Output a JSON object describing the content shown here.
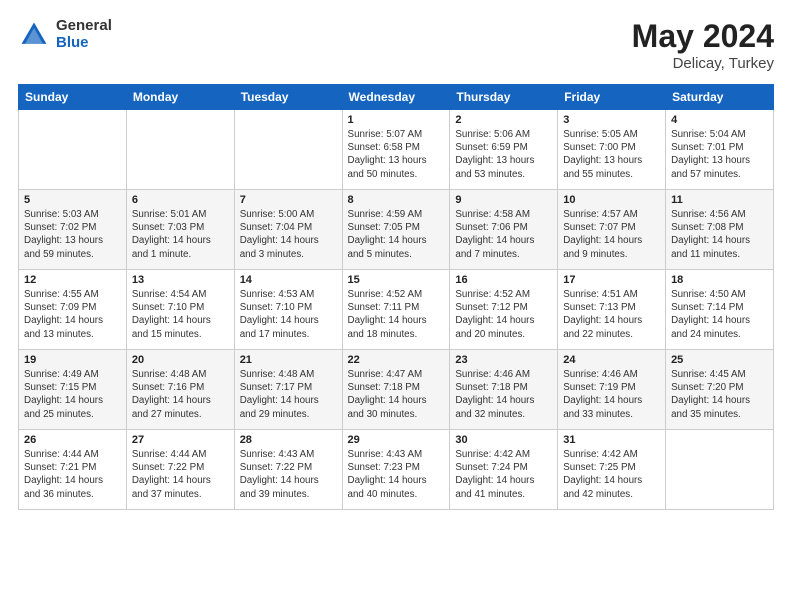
{
  "header": {
    "logo_general": "General",
    "logo_blue": "Blue",
    "title": "May 2024",
    "location": "Delicay, Turkey"
  },
  "days_of_week": [
    "Sunday",
    "Monday",
    "Tuesday",
    "Wednesday",
    "Thursday",
    "Friday",
    "Saturday"
  ],
  "weeks": [
    [
      {
        "day": "",
        "sunrise": "",
        "sunset": "",
        "daylight": ""
      },
      {
        "day": "",
        "sunrise": "",
        "sunset": "",
        "daylight": ""
      },
      {
        "day": "",
        "sunrise": "",
        "sunset": "",
        "daylight": ""
      },
      {
        "day": "1",
        "sunrise": "Sunrise: 5:07 AM",
        "sunset": "Sunset: 6:58 PM",
        "daylight": "Daylight: 13 hours and 50 minutes."
      },
      {
        "day": "2",
        "sunrise": "Sunrise: 5:06 AM",
        "sunset": "Sunset: 6:59 PM",
        "daylight": "Daylight: 13 hours and 53 minutes."
      },
      {
        "day": "3",
        "sunrise": "Sunrise: 5:05 AM",
        "sunset": "Sunset: 7:00 PM",
        "daylight": "Daylight: 13 hours and 55 minutes."
      },
      {
        "day": "4",
        "sunrise": "Sunrise: 5:04 AM",
        "sunset": "Sunset: 7:01 PM",
        "daylight": "Daylight: 13 hours and 57 minutes."
      }
    ],
    [
      {
        "day": "5",
        "sunrise": "Sunrise: 5:03 AM",
        "sunset": "Sunset: 7:02 PM",
        "daylight": "Daylight: 13 hours and 59 minutes."
      },
      {
        "day": "6",
        "sunrise": "Sunrise: 5:01 AM",
        "sunset": "Sunset: 7:03 PM",
        "daylight": "Daylight: 14 hours and 1 minute."
      },
      {
        "day": "7",
        "sunrise": "Sunrise: 5:00 AM",
        "sunset": "Sunset: 7:04 PM",
        "daylight": "Daylight: 14 hours and 3 minutes."
      },
      {
        "day": "8",
        "sunrise": "Sunrise: 4:59 AM",
        "sunset": "Sunset: 7:05 PM",
        "daylight": "Daylight: 14 hours and 5 minutes."
      },
      {
        "day": "9",
        "sunrise": "Sunrise: 4:58 AM",
        "sunset": "Sunset: 7:06 PM",
        "daylight": "Daylight: 14 hours and 7 minutes."
      },
      {
        "day": "10",
        "sunrise": "Sunrise: 4:57 AM",
        "sunset": "Sunset: 7:07 PM",
        "daylight": "Daylight: 14 hours and 9 minutes."
      },
      {
        "day": "11",
        "sunrise": "Sunrise: 4:56 AM",
        "sunset": "Sunset: 7:08 PM",
        "daylight": "Daylight: 14 hours and 11 minutes."
      }
    ],
    [
      {
        "day": "12",
        "sunrise": "Sunrise: 4:55 AM",
        "sunset": "Sunset: 7:09 PM",
        "daylight": "Daylight: 14 hours and 13 minutes."
      },
      {
        "day": "13",
        "sunrise": "Sunrise: 4:54 AM",
        "sunset": "Sunset: 7:10 PM",
        "daylight": "Daylight: 14 hours and 15 minutes."
      },
      {
        "day": "14",
        "sunrise": "Sunrise: 4:53 AM",
        "sunset": "Sunset: 7:10 PM",
        "daylight": "Daylight: 14 hours and 17 minutes."
      },
      {
        "day": "15",
        "sunrise": "Sunrise: 4:52 AM",
        "sunset": "Sunset: 7:11 PM",
        "daylight": "Daylight: 14 hours and 18 minutes."
      },
      {
        "day": "16",
        "sunrise": "Sunrise: 4:52 AM",
        "sunset": "Sunset: 7:12 PM",
        "daylight": "Daylight: 14 hours and 20 minutes."
      },
      {
        "day": "17",
        "sunrise": "Sunrise: 4:51 AM",
        "sunset": "Sunset: 7:13 PM",
        "daylight": "Daylight: 14 hours and 22 minutes."
      },
      {
        "day": "18",
        "sunrise": "Sunrise: 4:50 AM",
        "sunset": "Sunset: 7:14 PM",
        "daylight": "Daylight: 14 hours and 24 minutes."
      }
    ],
    [
      {
        "day": "19",
        "sunrise": "Sunrise: 4:49 AM",
        "sunset": "Sunset: 7:15 PM",
        "daylight": "Daylight: 14 hours and 25 minutes."
      },
      {
        "day": "20",
        "sunrise": "Sunrise: 4:48 AM",
        "sunset": "Sunset: 7:16 PM",
        "daylight": "Daylight: 14 hours and 27 minutes."
      },
      {
        "day": "21",
        "sunrise": "Sunrise: 4:48 AM",
        "sunset": "Sunset: 7:17 PM",
        "daylight": "Daylight: 14 hours and 29 minutes."
      },
      {
        "day": "22",
        "sunrise": "Sunrise: 4:47 AM",
        "sunset": "Sunset: 7:18 PM",
        "daylight": "Daylight: 14 hours and 30 minutes."
      },
      {
        "day": "23",
        "sunrise": "Sunrise: 4:46 AM",
        "sunset": "Sunset: 7:18 PM",
        "daylight": "Daylight: 14 hours and 32 minutes."
      },
      {
        "day": "24",
        "sunrise": "Sunrise: 4:46 AM",
        "sunset": "Sunset: 7:19 PM",
        "daylight": "Daylight: 14 hours and 33 minutes."
      },
      {
        "day": "25",
        "sunrise": "Sunrise: 4:45 AM",
        "sunset": "Sunset: 7:20 PM",
        "daylight": "Daylight: 14 hours and 35 minutes."
      }
    ],
    [
      {
        "day": "26",
        "sunrise": "Sunrise: 4:44 AM",
        "sunset": "Sunset: 7:21 PM",
        "daylight": "Daylight: 14 hours and 36 minutes."
      },
      {
        "day": "27",
        "sunrise": "Sunrise: 4:44 AM",
        "sunset": "Sunset: 7:22 PM",
        "daylight": "Daylight: 14 hours and 37 minutes."
      },
      {
        "day": "28",
        "sunrise": "Sunrise: 4:43 AM",
        "sunset": "Sunset: 7:22 PM",
        "daylight": "Daylight: 14 hours and 39 minutes."
      },
      {
        "day": "29",
        "sunrise": "Sunrise: 4:43 AM",
        "sunset": "Sunset: 7:23 PM",
        "daylight": "Daylight: 14 hours and 40 minutes."
      },
      {
        "day": "30",
        "sunrise": "Sunrise: 4:42 AM",
        "sunset": "Sunset: 7:24 PM",
        "daylight": "Daylight: 14 hours and 41 minutes."
      },
      {
        "day": "31",
        "sunrise": "Sunrise: 4:42 AM",
        "sunset": "Sunset: 7:25 PM",
        "daylight": "Daylight: 14 hours and 42 minutes."
      },
      {
        "day": "",
        "sunrise": "",
        "sunset": "",
        "daylight": ""
      }
    ]
  ]
}
